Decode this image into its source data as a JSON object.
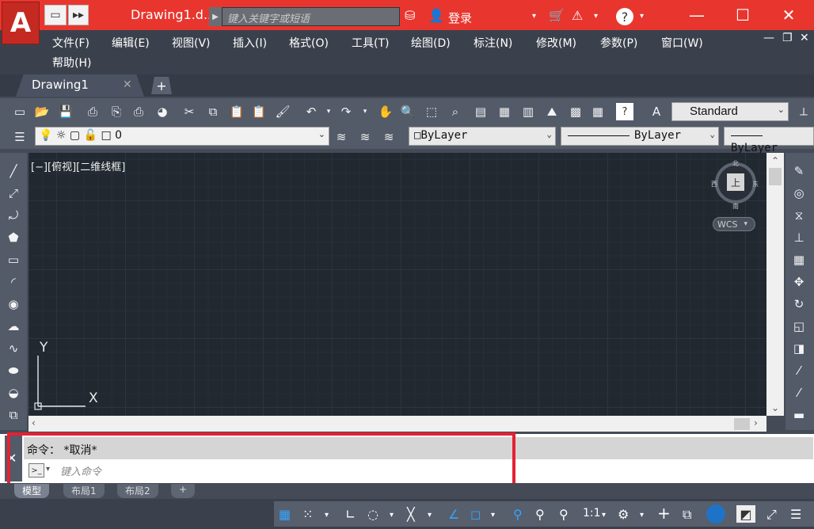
{
  "app": {
    "logo_letter": "A",
    "document_title": "Drawing1.d...",
    "search_placeholder": "键入关键字或短语",
    "login_label": "登录"
  },
  "menu": {
    "items": [
      "文件(F)",
      "编辑(E)",
      "视图(V)",
      "插入(I)",
      "格式(O)",
      "工具(T)",
      "绘图(D)",
      "标注(N)",
      "修改(M)",
      "参数(P)",
      "窗口(W)"
    ],
    "help": "帮助(H)"
  },
  "tabs": {
    "active": "Drawing1",
    "add": "+"
  },
  "toolbar": {
    "text_style": "Standard",
    "layer": "0",
    "color": "ByLayer",
    "linetype": "ByLayer",
    "lineweight": "ByLayer"
  },
  "viewport": {
    "label": "[−][俯视][二维线框]",
    "compass": {
      "north": "北",
      "south": "南",
      "east": "东",
      "west": "西",
      "top": "上"
    },
    "wcs": "WCS",
    "ucs_x": "X",
    "ucs_y": "Y"
  },
  "command": {
    "history": "命令： *取消*",
    "placeholder": "键入命令"
  },
  "layout_tabs": [
    "模型",
    "布局1",
    "布局2",
    "+"
  ],
  "status": {
    "scale": "1:1"
  },
  "colors": {
    "titlebar": "#e8362f",
    "highlight": "#e32233",
    "viewport_bg": "#212830",
    "accent": "#33a6ff"
  }
}
